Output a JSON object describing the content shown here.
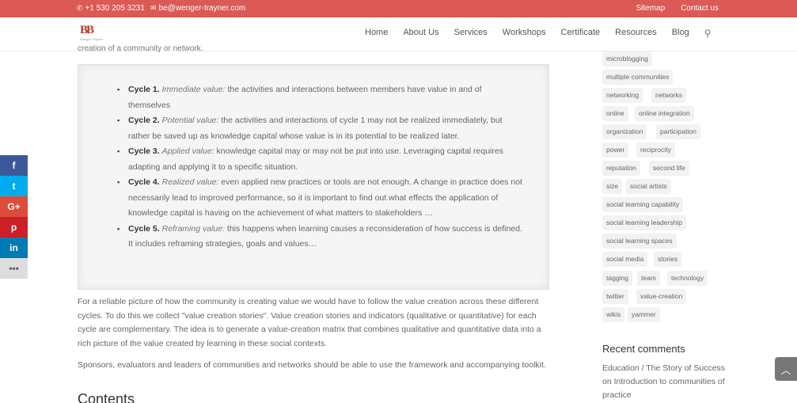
{
  "topbar": {
    "phone": "+1 530 205 3231",
    "email": "be@wenger-trayner.com",
    "links": [
      "Sitemap",
      "Contact us"
    ]
  },
  "header": {
    "logo_mark": "BB",
    "logo_sub": "Wenger-Trayner",
    "nav": [
      "Home",
      "About Us",
      "Services",
      "Workshops",
      "Certificate",
      "Resources",
      "Blog"
    ]
  },
  "main": {
    "clipped_line": "creation of a community or network.",
    "cycles": [
      {
        "label": "Cycle 1.",
        "title": "Immediate value:",
        "text": " the activities and interactions between members have value in and of themselves"
      },
      {
        "label": "Cycle 2.",
        "title": "Potential value:",
        "text": " the activities and interactions of cycle 1 may not be realized immediately, but rather be saved up as knowledge capital whose value is in its potential to be realized later."
      },
      {
        "label": "Cycle 3.",
        "title": "Applied value:",
        "text": " knowledge capital may or may not be put into use. Leveraging capital requires adapting and applying it to a specific situation."
      },
      {
        "label": "Cycle 4.",
        "title": "Realized value:",
        "text": " even applied new practices or tools are not enough. A change in practice does not necessarily lead to improved performance, so it is important to find out what effects the application of knowledge capital is having on the achievement of what matters to stakeholders …"
      },
      {
        "label": "Cycle 5.",
        "title": "Reframing value:",
        "text": " this happens when learning causes a reconsideration of how success is defined. It includes reframing strategies, goals and values…"
      }
    ],
    "paragraph1": "For a reliable picture of how the community is creating value we would have to follow the value creation across these different cycles. To do this we collect \"value creation stories\". Value creation stories and indicators (qualitative or quantitative) for each cycle are complementary. The idea is to generate a value-creation matrix that combines qualitative and quantitative data into a rich picture of the value created by learning in these social contexts.",
    "paragraph2": "Sponsors, evaluators and leaders of communities and networks should be able to use the framework and accompanying toolkit.",
    "contents_heading": "Contents"
  },
  "sidebar": {
    "tags": [
      "microblogging",
      "multiple communities",
      "networking",
      "networks",
      "online",
      "online integration",
      "organization",
      "participation",
      "power",
      "reciprocity",
      "reputation",
      "second life",
      "size",
      "social artists",
      "social learning capability",
      "social learning leadership",
      "social learning spaces",
      "social media",
      "stories",
      "tagging",
      "team",
      "technology",
      "twitter",
      "value-creation",
      "wikis",
      "yammer"
    ],
    "recent_title": "Recent comments",
    "recent_text": "Education / The Story of Success on Introduction to communities of practice"
  },
  "share": {
    "facebook": "f",
    "twitter": "t",
    "googleplus": "G+",
    "pinterest": "p",
    "linkedin": "in",
    "more": "•••"
  },
  "back_to_top_icon": "chevron-up-icon"
}
